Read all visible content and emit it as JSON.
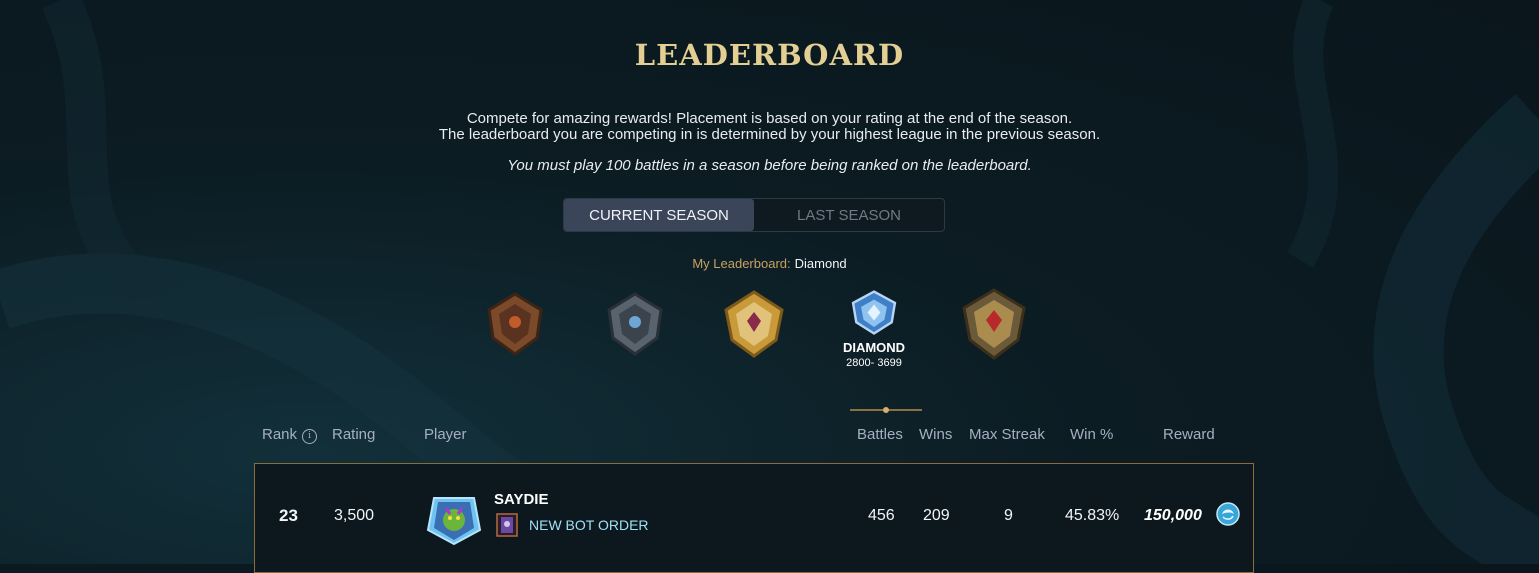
{
  "page": {
    "title": "LEADERBOARD",
    "description_line1": "Compete for amazing rewards! Placement is based on your rating at the end of the season.",
    "description_line2": "The leaderboard you are competing in is determined by your highest league in the previous season.",
    "note": "You must play 100 battles in a season before being ranked on the leaderboard."
  },
  "tabs": [
    {
      "label": "CURRENT SEASON",
      "active": true
    },
    {
      "label": "LAST SEASON",
      "active": false
    }
  ],
  "my_leaderboard": {
    "label": "My Leaderboard:",
    "value": "Diamond"
  },
  "leagues": [
    {
      "icon": "bronze-league-badge-icon"
    },
    {
      "icon": "silver-league-badge-icon"
    },
    {
      "icon": "gold-league-badge-icon"
    },
    {
      "icon": "diamond-league-badge-icon",
      "name": "DIAMOND",
      "range": "2800- 3699",
      "selected": true
    },
    {
      "icon": "champion-league-badge-icon"
    }
  ],
  "table": {
    "headers": {
      "rank": "Rank",
      "rating": "Rating",
      "player": "Player",
      "battles": "Battles",
      "wins": "Wins",
      "max_streak": "Max Streak",
      "win_pct": "Win %",
      "reward": "Reward"
    },
    "rows": [
      {
        "rank": "23",
        "rating": "3,500",
        "player": "SAYDIE",
        "guild": "NEW BOT ORDER",
        "battles": "456",
        "wins": "209",
        "max_streak": "9",
        "win_pct": "45.83%",
        "reward": "150,000",
        "reward_icon": "crystal-coin-icon"
      }
    ]
  },
  "colors": {
    "accent_gold": "#e3cf93",
    "label_gold": "#c8a062",
    "guild_cyan": "#9fe0f5",
    "row_border": "#8b6c3a"
  }
}
